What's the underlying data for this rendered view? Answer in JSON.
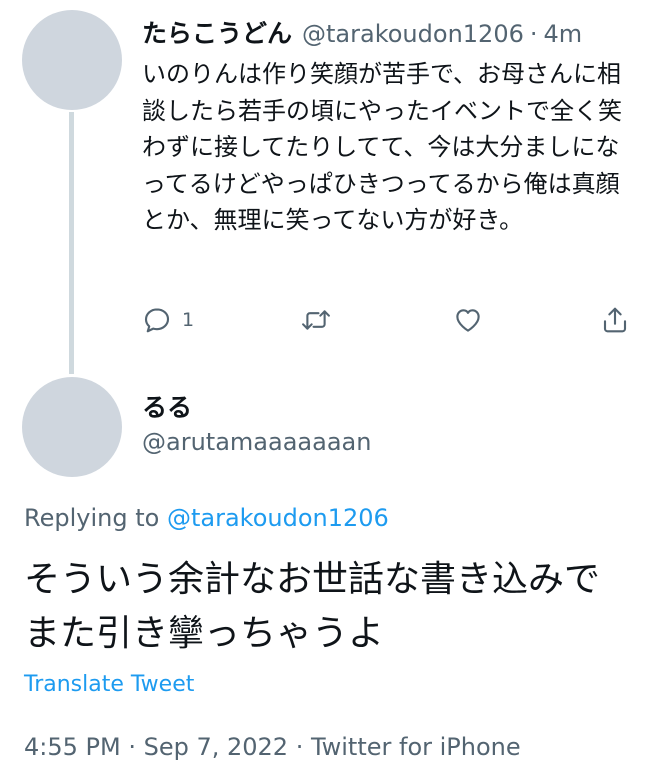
{
  "parent_tweet": {
    "display_name": "たらこうどん",
    "handle": "@tarakoudon1206",
    "separator": "·",
    "time_ago": "4m",
    "text": "いのりんは作り笑顔が苦手で、お母さんに相談したら若手の頃にやったイベントで全く笑わずに接してたりしてて、今は大分ましになってるけどやっぱひきつってるから俺は真顔とか、無理に笑ってない方が好き。",
    "actions": {
      "reply_count": "1",
      "reply_icon": "reply-icon",
      "retweet_icon": "retweet-icon",
      "like_icon": "like-icon",
      "share_icon": "share-icon"
    }
  },
  "reply_tweet": {
    "display_name": "るる",
    "handle": "@arutamaaaaaaan",
    "replying_label": "Replying to",
    "replying_handle": "@tarakoudon1206",
    "text": "そういう余計なお世話な書き込みでまた引き攣っちゃうよ",
    "translate_label": "Translate Tweet",
    "meta": "4:55 PM · Sep 7, 2022 · Twitter for iPhone"
  },
  "colors": {
    "avatar": "#cfd6de",
    "thread_line": "#cfd9de",
    "primary_text": "#0f1419",
    "secondary_text": "#536471",
    "link": "#1d9bf0"
  }
}
